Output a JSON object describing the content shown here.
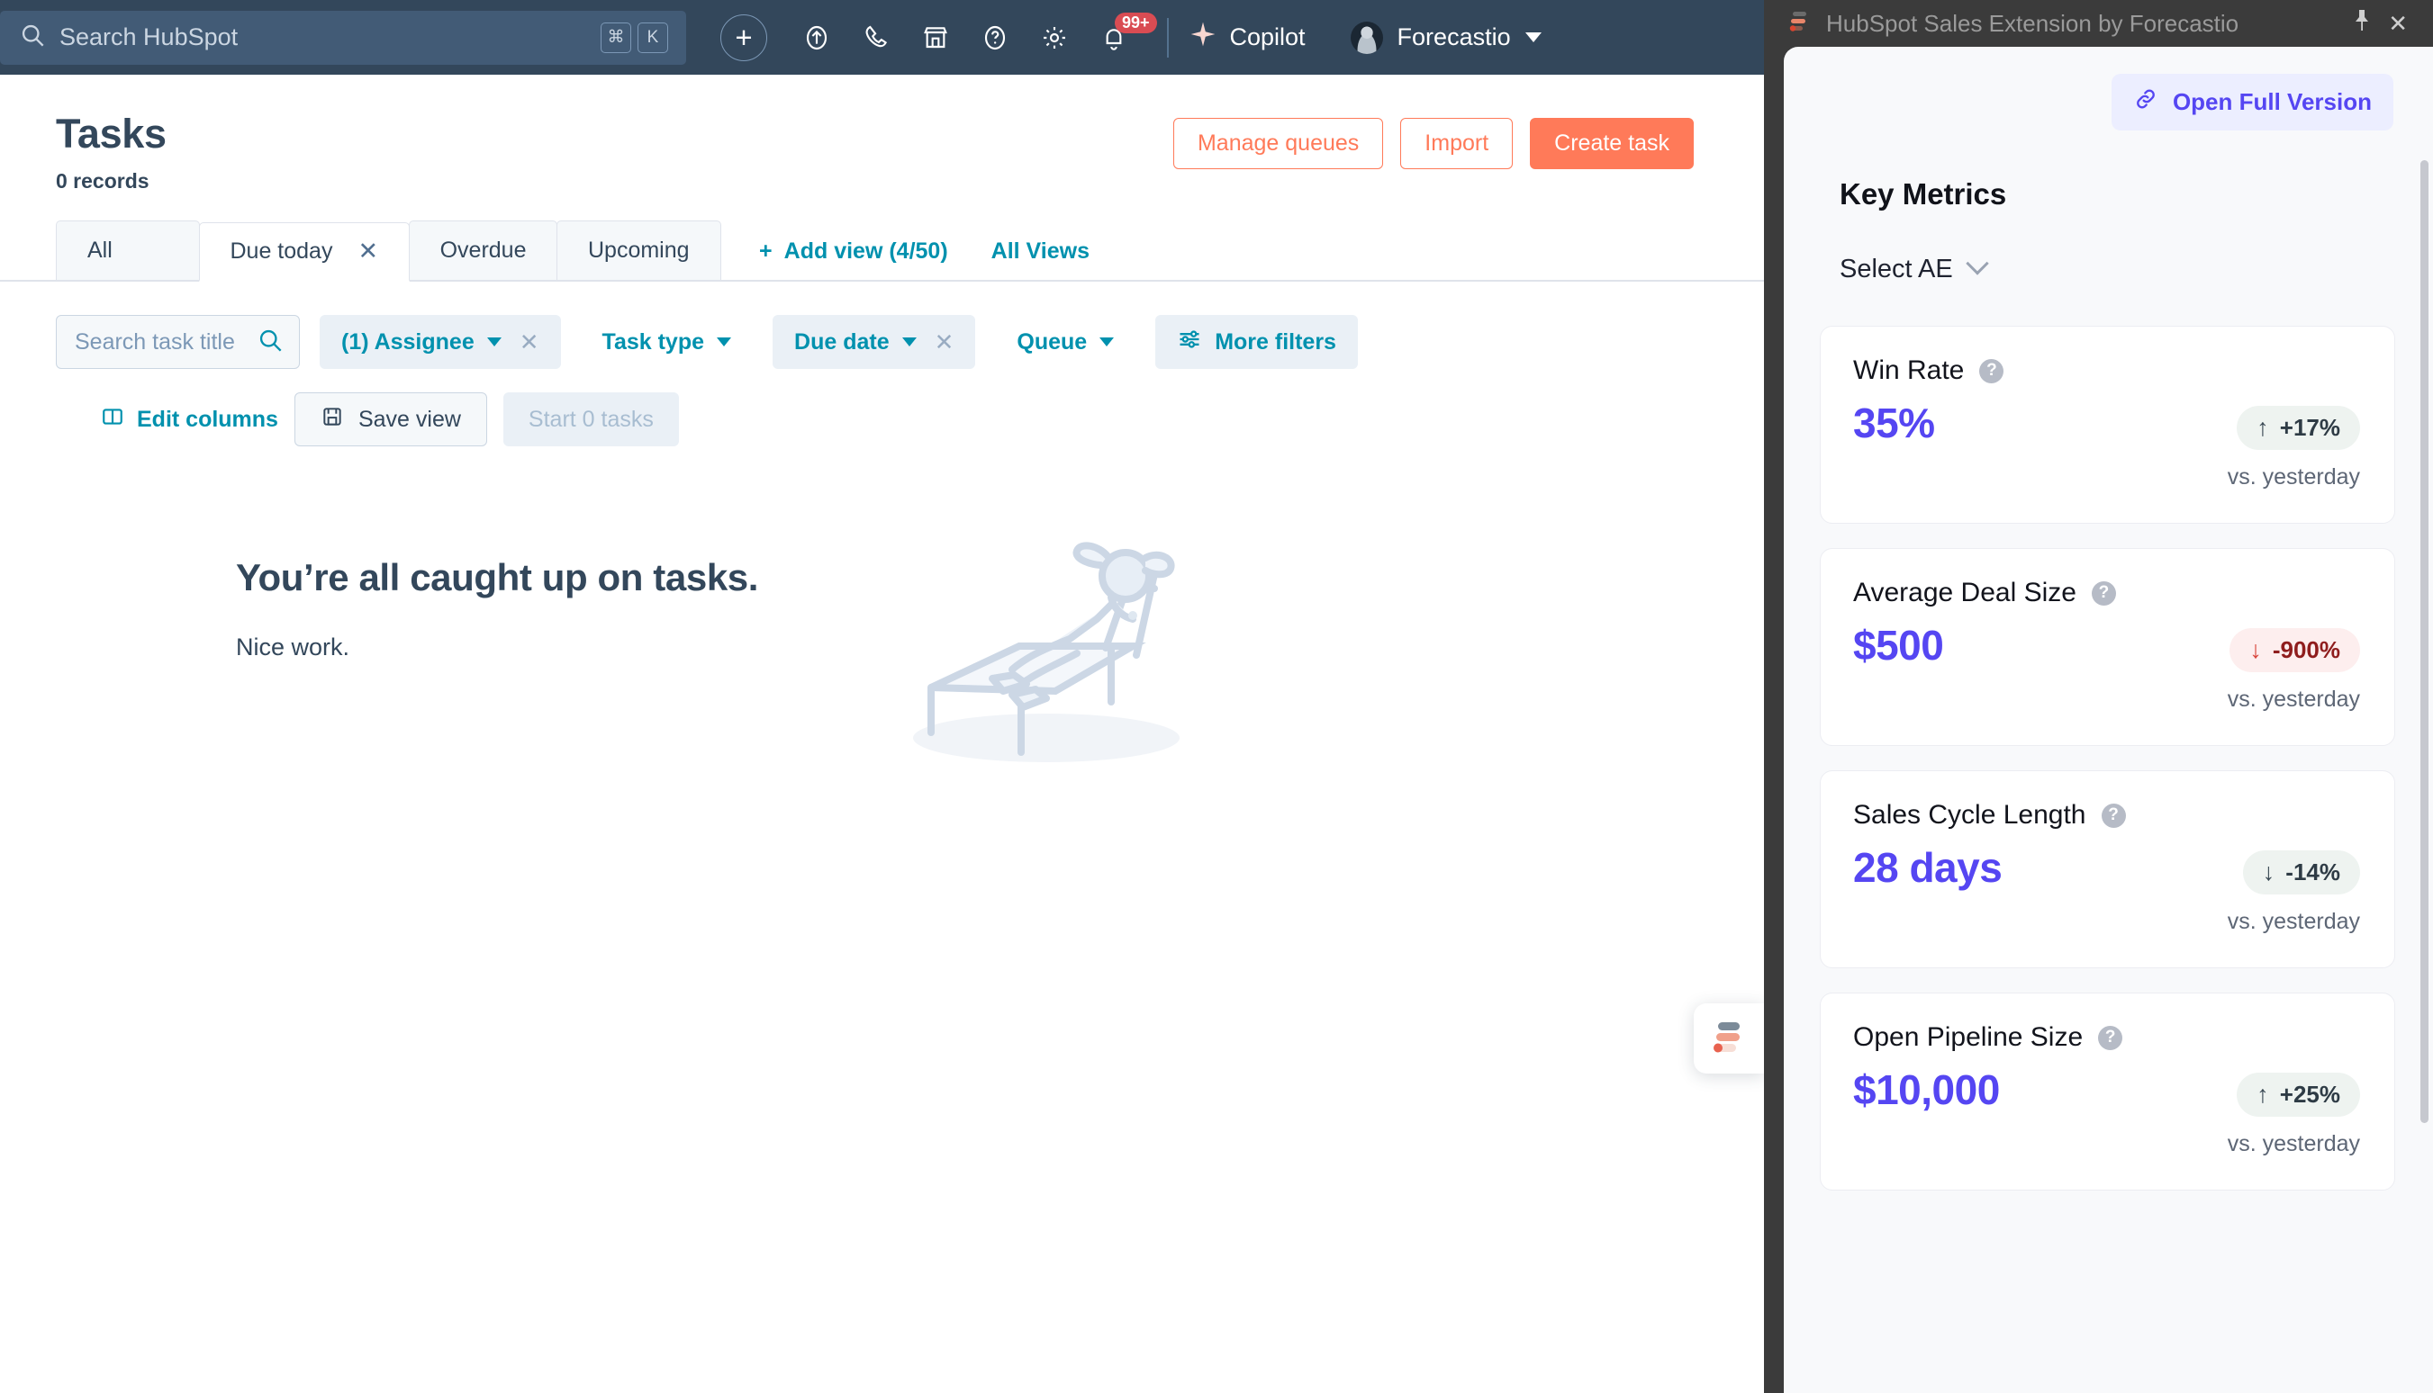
{
  "topnav": {
    "search_placeholder": "Search HubSpot",
    "shortcut_keys": [
      "⌘",
      "K"
    ],
    "add_icon": "plus-icon",
    "icons": [
      {
        "name": "upgrade-icon",
        "label": "Upgrade"
      },
      {
        "name": "phone-icon",
        "label": "Calling"
      },
      {
        "name": "marketplace-icon",
        "label": "Marketplace"
      },
      {
        "name": "help-icon",
        "label": "Help"
      },
      {
        "name": "settings-gear-icon",
        "label": "Settings"
      },
      {
        "name": "notifications-bell-icon",
        "label": "Notifications"
      }
    ],
    "notification_count": "99+",
    "copilot_label": "Copilot",
    "account_name": "Forecastio"
  },
  "page": {
    "title": "Tasks",
    "record_count": "0 records",
    "actions": [
      {
        "label": "Manage queues",
        "style": "secondary"
      },
      {
        "label": "Import",
        "style": "secondary"
      },
      {
        "label": "Create task",
        "style": "primary"
      }
    ]
  },
  "tabs": {
    "items": [
      {
        "label": "All",
        "active": false,
        "closable": false
      },
      {
        "label": "Due today",
        "active": true,
        "closable": true
      },
      {
        "label": "Overdue",
        "active": false,
        "closable": false
      },
      {
        "label": "Upcoming",
        "active": false,
        "closable": false
      }
    ],
    "add_view_label": "Add view (4/50)",
    "all_views_label": "All Views"
  },
  "filters": {
    "search_placeholder": "Search task title",
    "chips": [
      {
        "label": "(1) Assignee",
        "active": true,
        "clearable": true
      },
      {
        "label": "Task type",
        "active": false,
        "clearable": false
      },
      {
        "label": "Due date",
        "active": true,
        "clearable": true
      },
      {
        "label": "Queue",
        "active": false,
        "clearable": false
      }
    ],
    "more_filters_label": "More filters"
  },
  "column_actions": {
    "edit_columns_label": "Edit columns",
    "save_view_label": "Save view",
    "start_tasks_label": "Start 0 tasks"
  },
  "empty_state": {
    "heading": "You’re all caught up on tasks.",
    "subtext": "Nice work.",
    "illustration": "person-relaxing-on-lounge-chair"
  },
  "floating_widget": {
    "icon": "forecastio-bars-icon"
  },
  "extension": {
    "title": "HubSpot Sales Extension by Forecastio",
    "pin_icon": "pin-icon",
    "close_icon": "close-icon",
    "open_full_version_label": "Open Full Version",
    "key_metrics_title": "Key Metrics",
    "ae_selector_label": "Select AE",
    "comparison_label": "vs. yesterday",
    "accent_color": "#5546f2",
    "metrics": [
      {
        "label": "Win Rate",
        "value": "35%",
        "delta": "+17%",
        "direction": "up",
        "tone": "neutral",
        "comparison": "vs. yesterday"
      },
      {
        "label": "Average Deal Size",
        "value": "$500",
        "delta": "-900%",
        "direction": "down",
        "tone": "bad",
        "comparison": "vs. yesterday"
      },
      {
        "label": "Sales Cycle Length",
        "value": "28 days",
        "delta": "-14%",
        "direction": "down",
        "tone": "neutral",
        "comparison": "vs. yesterday"
      },
      {
        "label": "Open Pipeline Size",
        "value": "$10,000",
        "delta": "+25%",
        "direction": "up",
        "tone": "neutral",
        "comparison": "vs. yesterday"
      }
    ]
  }
}
